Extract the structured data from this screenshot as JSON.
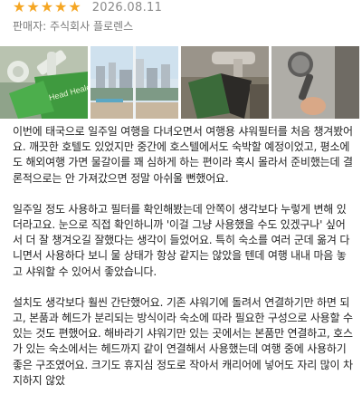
{
  "review": {
    "rating": 5,
    "rating_max": 5,
    "star_color": "#f5a623",
    "date": "2026.08.11",
    "seller_label": "판매자: 주식회사 플로렌스"
  },
  "photos": {
    "count": 5,
    "product_box_text": "Head Healer",
    "icons": [
      "shower-filter-photo",
      "hotel-window-photo",
      "book-and-faucet-photo",
      "shower-head-hand-photo",
      "shower-wall-photo"
    ]
  },
  "body": {
    "paragraphs": [
      "이번에 태국으로 일주일 여행을 다녀오면서 여행용 샤워필터를 처음 챙겨봤어요. 깨끗한 호텔도 있었지만 중간에 호스텔에서도 숙박할 예정이었고, 평소에도 해외여행 가면 물갈이를 꽤 심하게 하는 편이라 혹시 몰라서 준비했는데 결론적으로는 안 가져갔으면 정말 아쉬울 뻔했어요.",
      "일주일 정도 사용하고 필터를 확인해봤는데 안쪽이 생각보다 누렇게 변해 있더라고요. 눈으로 직접 확인하니까 '이걸 그냥 사용했을 수도 있겠구나' 싶어서 더 잘 챙겨오길 잘했다는 생각이 들었어요. 특히 숙소를 여러 군데 옮겨 다니면서 사용하다 보니 물 상태가 항상 같지는 않았을 텐데 여행 내내 마음 놓고 샤워할 수 있어서 좋았습니다.",
      "설치도 생각보다 훨씬 간단했어요. 기존 샤워기에 돌려서 연결하기만 하면 되고, 본품과 헤드가 분리되는 방식이라 숙소에 따라 필요한 구성으로 사용할 수 있는 것도 편했어요. 해바라기 샤워기만 있는 곳에서는 본품만 연결하고, 호스가 있는 숙소에서는 헤드까지 같이 연결해서 사용했는데 여행 중에 사용하기 좋은 구조였어요. 크기도 휴지심 정도로 작아서 캐리어에 넣어도 자리 많이 차지하지 않았"
    ]
  }
}
